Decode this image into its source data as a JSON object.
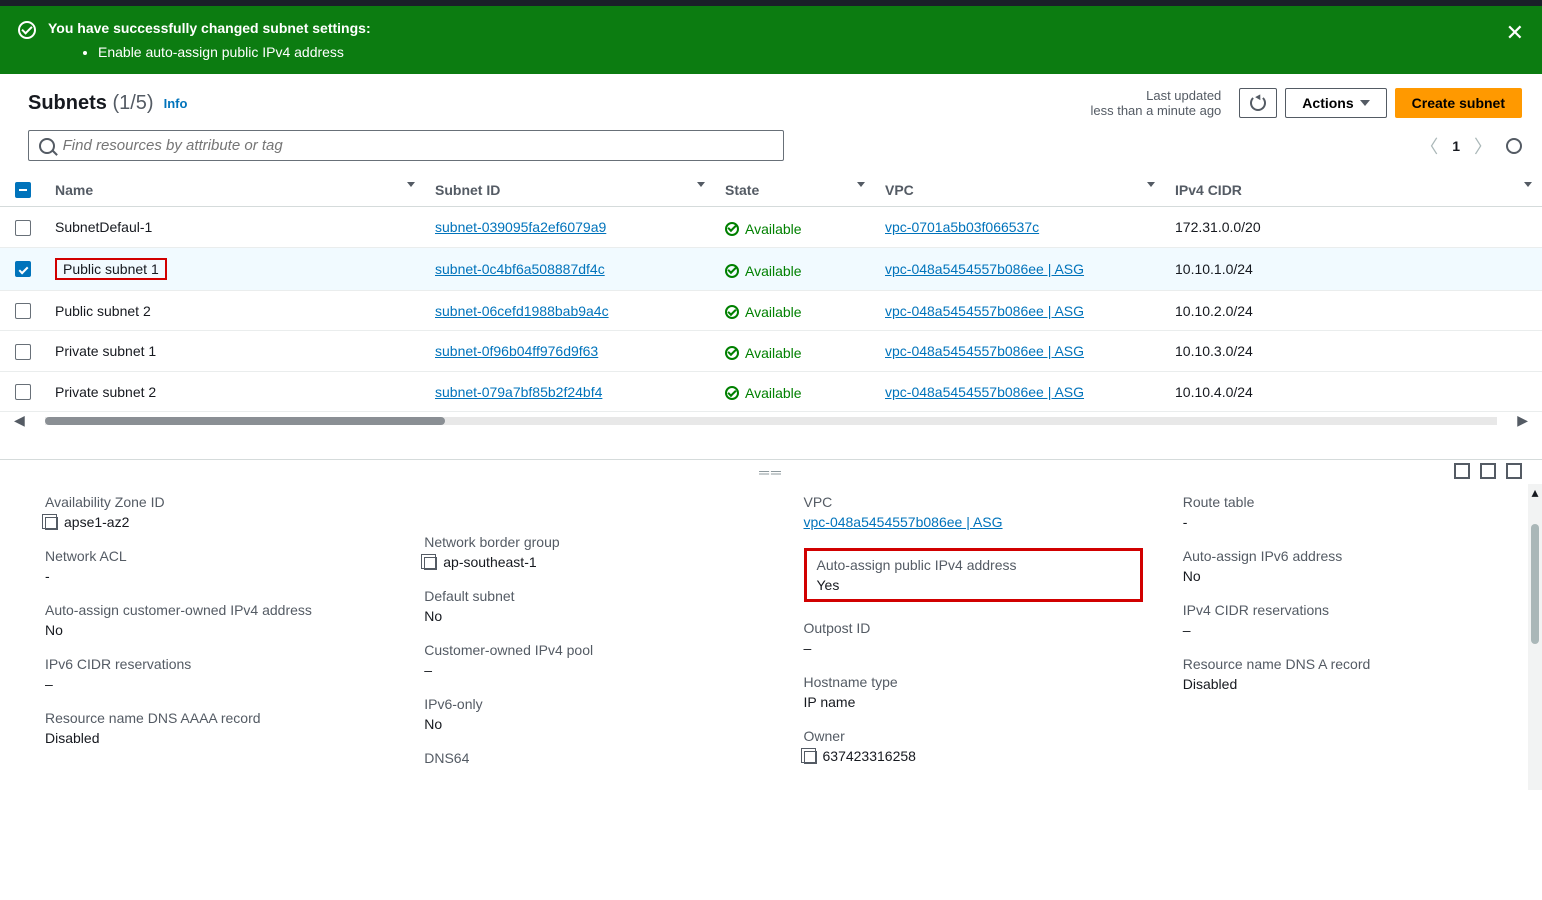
{
  "banner": {
    "title": "You have successfully changed subnet settings:",
    "bullet": "Enable auto-assign public IPv4 address"
  },
  "header": {
    "title": "Subnets",
    "count": "(1/5)",
    "info": "Info",
    "last_updated_l1": "Last updated",
    "last_updated_l2": "less than a minute ago",
    "actions": "Actions",
    "create": "Create subnet"
  },
  "search": {
    "placeholder": "Find resources by attribute or tag"
  },
  "pager": {
    "page": "1"
  },
  "columns": {
    "name": "Name",
    "subnet_id": "Subnet ID",
    "state": "State",
    "vpc": "VPC",
    "cidr": "IPv4 CIDR"
  },
  "rows": [
    {
      "name": "SubnetDefaul-1",
      "subnet_id": "subnet-039095fa2ef6079a9",
      "state": "Available",
      "vpc": "vpc-0701a5b03f066537c",
      "cidr": "172.31.0.0/20",
      "selected": false,
      "highlight": false
    },
    {
      "name": "Public subnet 1",
      "subnet_id": "subnet-0c4bf6a508887df4c",
      "state": "Available",
      "vpc": "vpc-048a5454557b086ee | ASG",
      "cidr": "10.10.1.0/24",
      "selected": true,
      "highlight": true
    },
    {
      "name": "Public subnet 2",
      "subnet_id": "subnet-06cefd1988bab9a4c",
      "state": "Available",
      "vpc": "vpc-048a5454557b086ee | ASG",
      "cidr": "10.10.2.0/24",
      "selected": false,
      "highlight": false
    },
    {
      "name": "Private subnet 1",
      "subnet_id": "subnet-0f96b04ff976d9f63",
      "state": "Available",
      "vpc": "vpc-048a5454557b086ee | ASG",
      "cidr": "10.10.3.0/24",
      "selected": false,
      "highlight": false
    },
    {
      "name": "Private subnet 2",
      "subnet_id": "subnet-079a7bf85b2f24bf4",
      "state": "Available",
      "vpc": "vpc-048a5454557b086ee | ASG",
      "cidr": "10.10.4.0/24",
      "selected": false,
      "highlight": false
    }
  ],
  "details": {
    "col1": {
      "az_id_lbl": "Availability Zone ID",
      "az_id_val": "apse1-az2",
      "nacl_lbl": "Network ACL",
      "nacl_val": "-",
      "aacoi_lbl": "Auto-assign customer-owned IPv4 address",
      "aacoi_val": "No",
      "v6res_lbl": "IPv6 CIDR reservations",
      "v6res_val": "–",
      "aaaa_lbl": "Resource name DNS AAAA record",
      "aaaa_val": "Disabled"
    },
    "col2": {
      "nbg_lbl": "Network border group",
      "nbg_val": "ap-southeast-1",
      "def_lbl": "Default subnet",
      "def_val": "No",
      "copool_lbl": "Customer-owned IPv4 pool",
      "copool_val": "–",
      "v6only_lbl": "IPv6-only",
      "v6only_val": "No",
      "dns64_lbl": "DNS64"
    },
    "col3": {
      "vpc_lbl": "VPC",
      "vpc_val": "vpc-048a5454557b086ee | ASG",
      "aav4_lbl": "Auto-assign public IPv4 address",
      "aav4_val": "Yes",
      "outpost_lbl": "Outpost ID",
      "outpost_val": "–",
      "host_lbl": "Hostname type",
      "host_val": "IP name",
      "owner_lbl": "Owner",
      "owner_val": "637423316258"
    },
    "col4": {
      "rt_lbl": "Route table",
      "rt_val": "-",
      "aav6_lbl": "Auto-assign IPv6 address",
      "aav6_val": "No",
      "v4res_lbl": "IPv4 CIDR reservations",
      "v4res_val": "–",
      "arec_lbl": "Resource name DNS A record",
      "arec_val": "Disabled"
    }
  }
}
